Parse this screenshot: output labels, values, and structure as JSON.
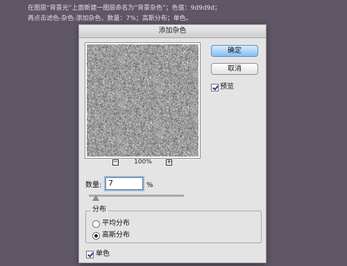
{
  "instructions": {
    "line1": "在图层“背景光”上面新建一图层命名为“背景杂色”；色值：9d9d9d；",
    "line2": "再点击滤色-杂色-添加杂色，数量：7%；高斯分布；单色。"
  },
  "dialog": {
    "title": "添加杂色",
    "ok_label": "确定",
    "cancel_label": "取消",
    "preview_label": "预览",
    "preview_checked": true,
    "zoom": {
      "minus": "−",
      "value": "100%",
      "plus": "+"
    },
    "amount": {
      "label": "数量:",
      "value": "7",
      "unit": "%",
      "slider_fraction": 0.07
    },
    "distribution": {
      "title": "分布",
      "options": [
        {
          "label": "平均分布",
          "selected": false
        },
        {
          "label": "高斯分布",
          "selected": true
        }
      ]
    },
    "monochrome_label": "单色",
    "monochrome_checked": true
  },
  "colors": {
    "background": "#5f5666",
    "noise_base": "#9d9d9d",
    "primary_button": "#86c0f5"
  }
}
